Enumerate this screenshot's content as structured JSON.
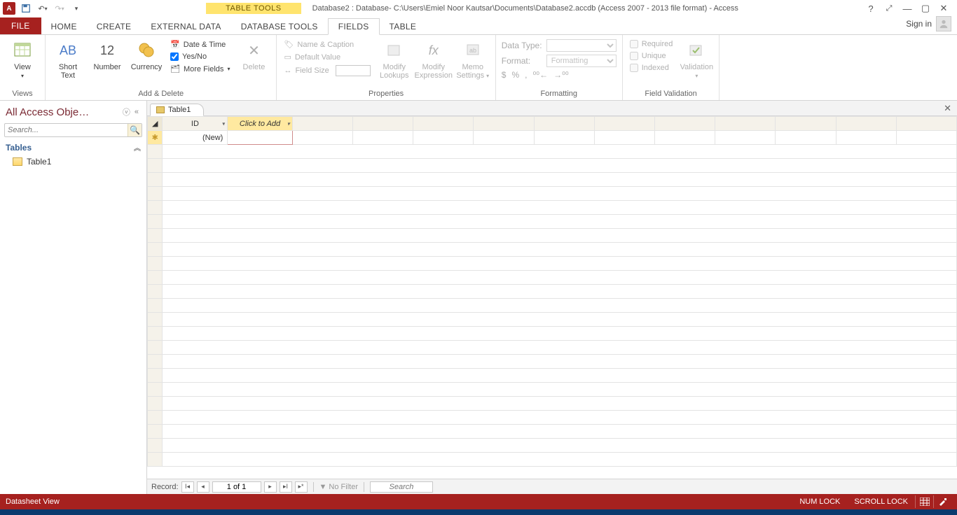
{
  "titlebar": {
    "table_tools": "TABLE TOOLS",
    "title": "Database2 : Database- C:\\Users\\Emiel Noor Kautsar\\Documents\\Database2.accdb (Access 2007 - 2013 file format) - Access"
  },
  "tabs": {
    "file": "FILE",
    "home": "HOME",
    "create": "CREATE",
    "external": "EXTERNAL DATA",
    "dbtools": "DATABASE TOOLS",
    "fields": "FIELDS",
    "table": "TABLE",
    "signin": "Sign in"
  },
  "ribbon": {
    "views": {
      "view": "View",
      "group": "Views"
    },
    "add_delete": {
      "short_text": "Short Text",
      "number": "Number",
      "currency": "Currency",
      "date_time": "Date & Time",
      "yes_no": "Yes/No",
      "more_fields": "More Fields",
      "delete": "Delete",
      "group": "Add & Delete",
      "ab": "AB",
      "twelve": "12"
    },
    "properties": {
      "name_caption": "Name & Caption",
      "default_value": "Default Value",
      "field_size": "Field Size",
      "modify_lookups": "Modify Lookups",
      "modify_expression": "Modify Expression",
      "memo_settings": "Memo Settings",
      "group": "Properties"
    },
    "formatting": {
      "data_type_lbl": "Data Type:",
      "data_type_val": "",
      "format_lbl": "Format:",
      "format_val": "Formatting",
      "currency_sym": "$",
      "percent_sym": "%",
      "comma_sym": ",",
      "inc_dec": "⁰₀",
      "group": "Formatting"
    },
    "validation": {
      "required": "Required",
      "unique": "Unique",
      "indexed": "Indexed",
      "validation": "Validation",
      "group": "Field Validation"
    }
  },
  "nav": {
    "title": "All Access Obje…",
    "search_placeholder": "Search...",
    "tables_header": "Tables",
    "items": [
      "Table1"
    ]
  },
  "doc": {
    "tab_name": "Table1",
    "col_id": "ID",
    "col_add": "Click to Add",
    "row_new": "(New)"
  },
  "recordnav": {
    "label": "Record:",
    "pos": "1 of 1",
    "no_filter": "No Filter",
    "search": "Search"
  },
  "status": {
    "view": "Datasheet View",
    "numlock": "NUM LOCK",
    "scrolllock": "SCROLL LOCK"
  }
}
